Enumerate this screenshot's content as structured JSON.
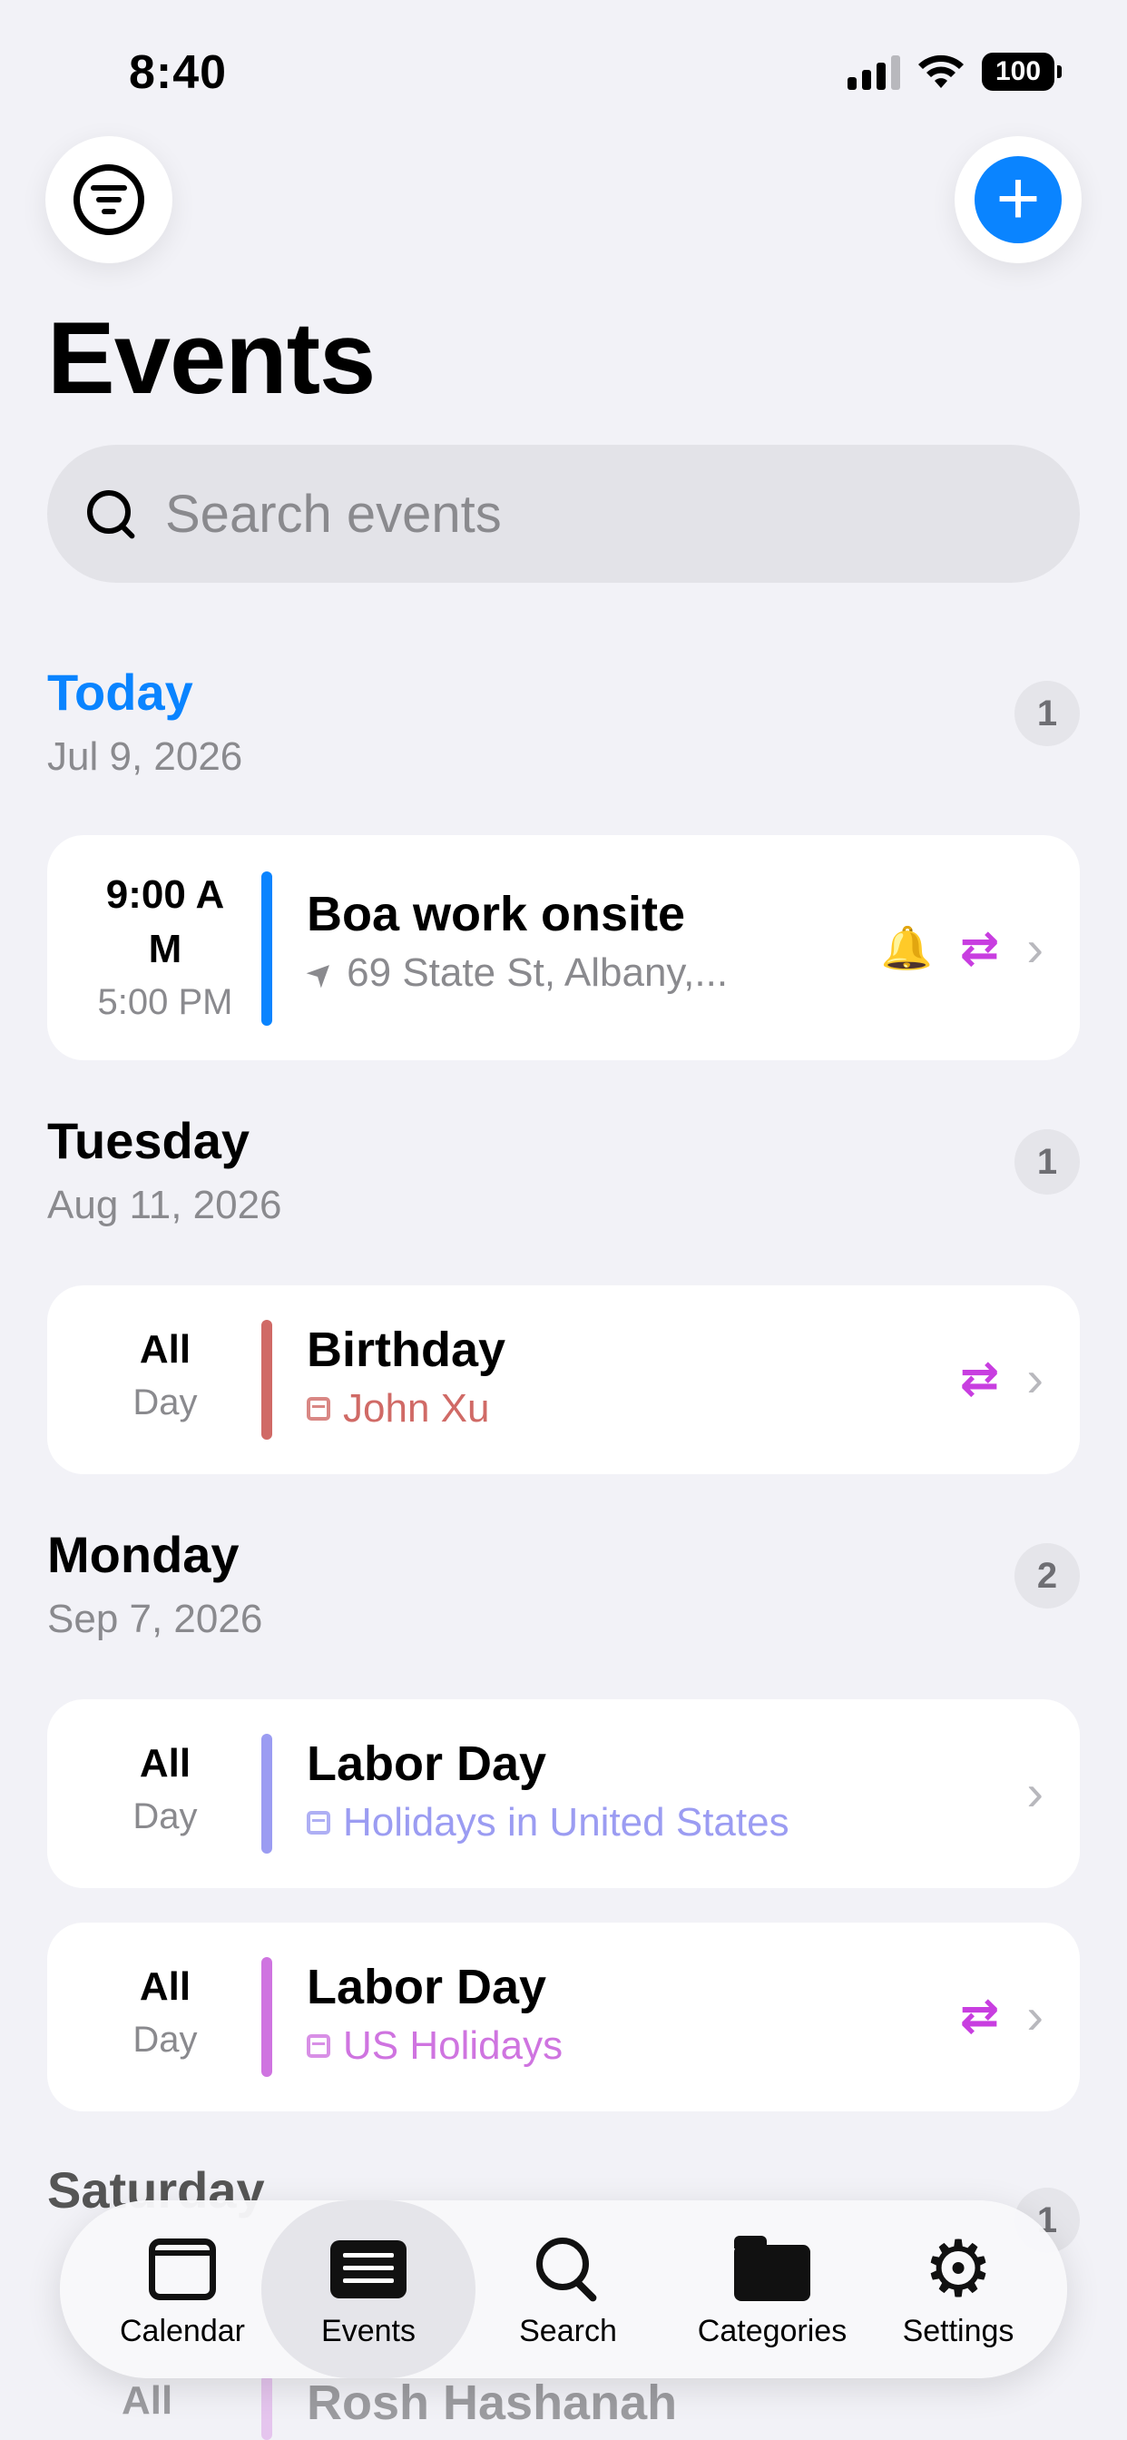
{
  "status": {
    "time": "8:40",
    "battery": "100"
  },
  "header": {
    "title": "Events"
  },
  "search": {
    "placeholder": "Search events"
  },
  "sections": [
    {
      "name": "Today",
      "date": "Jul 9, 2026",
      "count": "1",
      "events": [
        {
          "time_start": "9:00 A\nM",
          "time_end": "5:00 PM",
          "title": "Boa work onsite",
          "subtitle": "69 State St, Albany,...",
          "color": "#0a84ff",
          "has_alert": true,
          "repeats": true
        }
      ]
    },
    {
      "name": "Tuesday",
      "date": "Aug 11, 2026",
      "count": "1",
      "events": [
        {
          "allday_1": "All",
          "allday_2": "Day",
          "title": "Birthday",
          "subtitle": "John Xu",
          "color": "#d06a66",
          "repeats": true
        }
      ]
    },
    {
      "name": "Monday",
      "date": "Sep 7, 2026",
      "count": "2",
      "events": [
        {
          "allday_1": "All",
          "allday_2": "Day",
          "title": "Labor Day",
          "subtitle": "Holidays in United States",
          "color": "#9b9cf2",
          "repeats": false
        },
        {
          "allday_1": "All",
          "allday_2": "Day",
          "title": "Labor Day",
          "subtitle": "US Holidays",
          "color": "#cf74e0",
          "repeats": true
        }
      ]
    },
    {
      "name": "Saturday",
      "count": "1",
      "events": [
        {
          "allday_1": "All",
          "title": "Rosh Hashanah"
        }
      ]
    }
  ],
  "tabs": [
    {
      "label": "Calendar",
      "icon": "calendar-icon"
    },
    {
      "label": "Events",
      "icon": "list-icon",
      "active": true
    },
    {
      "label": "Search",
      "icon": "search-icon"
    },
    {
      "label": "Categories",
      "icon": "folder-icon"
    },
    {
      "label": "Settings",
      "icon": "gear-icon"
    }
  ]
}
